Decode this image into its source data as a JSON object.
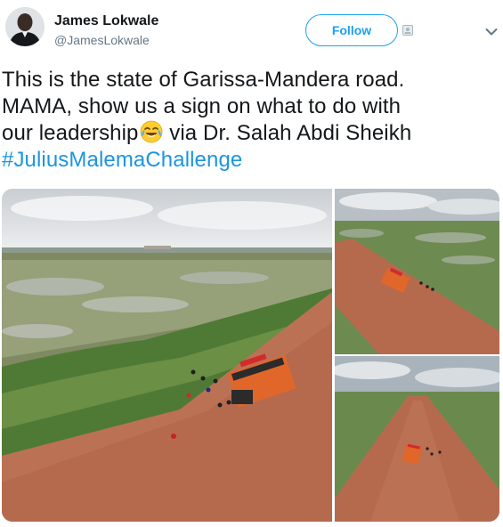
{
  "user": {
    "display_name": "James Lokwale",
    "handle": "@JamesLokwale"
  },
  "follow_button": {
    "label": "Follow"
  },
  "tweet": {
    "line_1": "This is the state of Garissa-Mandera road.",
    "line_2": "MAMA, show us a sign on what to do with",
    "line_3_before_emoji": "our leadership",
    "line_3_after_emoji": " via Dr. Salah Abdi Sheikh",
    "hashtag": "#JuliusMalemaChallenge"
  },
  "icons": {
    "avatar": "avatar-portrait",
    "notification": "mini-profile-icon",
    "emoji": "face-with-tears-of-joy-icon",
    "chevron": "chevron-down-icon"
  },
  "colors": {
    "accent": "#1da1f2",
    "hashtag": "#1b95e0",
    "text": "#14171a",
    "secondary_text": "#657786",
    "floodwater": "#b86e52",
    "bus": "#e0662a"
  },
  "media": {
    "photos": [
      {
        "id": "aerial-wide",
        "subject": "flooded road with stranded bus"
      },
      {
        "id": "aerial-top-right",
        "subject": "flooded road with stranded bus"
      },
      {
        "id": "aerial-bottom-right",
        "subject": "flooded road with stranded bus"
      }
    ]
  }
}
